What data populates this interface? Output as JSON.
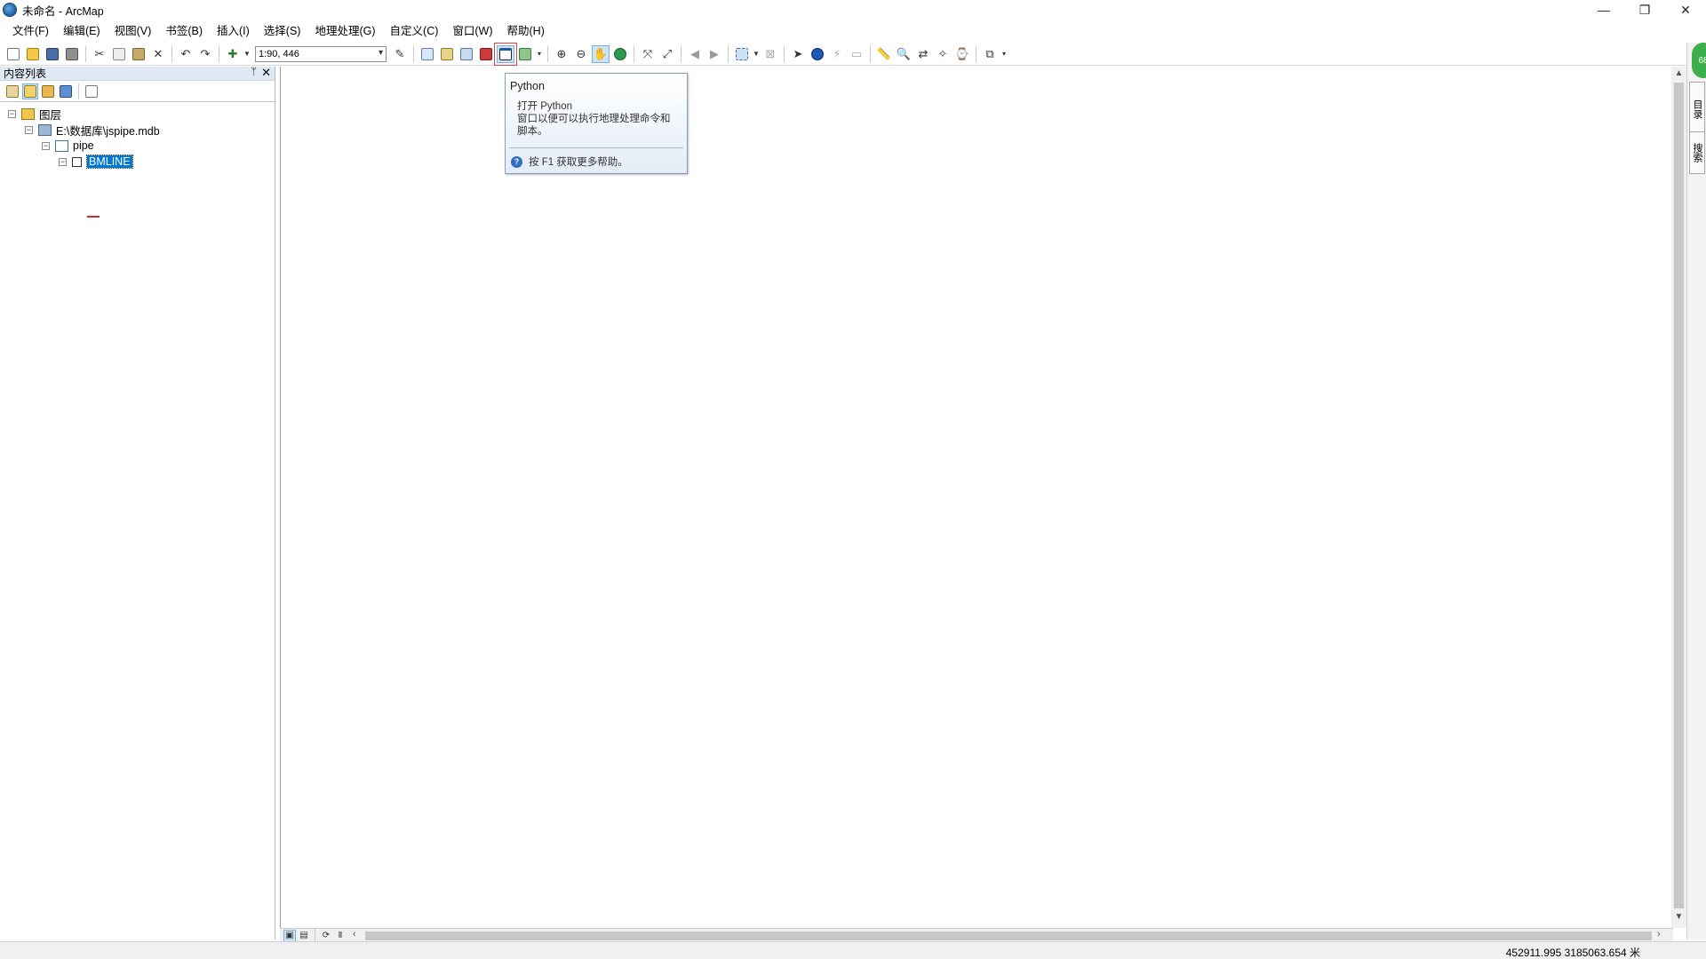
{
  "window": {
    "title": "未命名 - ArcMap",
    "minimize": "—",
    "restore": "❐",
    "close": "✕"
  },
  "menu": [
    "文件(F)",
    "编辑(E)",
    "视图(V)",
    "书签(B)",
    "插入(I)",
    "选择(S)",
    "地理处理(G)",
    "自定义(C)",
    "窗口(W)",
    "帮助(H)"
  ],
  "toolbar": {
    "scale": "1:90, 446"
  },
  "toc": {
    "title": "内容列表",
    "pin": "ᛘ",
    "close": "✕",
    "layers_label": "图层",
    "db_label": "E:\\数据库\\jspipe.mdb",
    "dataset_label": "pipe",
    "feature_label": "BMLINE",
    "expander": "−"
  },
  "tooltip": {
    "title": "Python",
    "body_line1": "打开 Python",
    "body_line2": "窗口以便可以执行地理处理命令和",
    "body_line3": "脚本。",
    "help": "按 F1 获取更多帮助。",
    "help_icon": "?"
  },
  "status": {
    "coordinates": "452911.995  3185063.654 米"
  },
  "right_dock": {
    "badge": "68",
    "tab1": "目录",
    "tab2": "搜索"
  },
  "colors": {
    "selection": "#0078d7",
    "highlight_border": "#e04040",
    "feature_symbol": "#d62b2b"
  }
}
